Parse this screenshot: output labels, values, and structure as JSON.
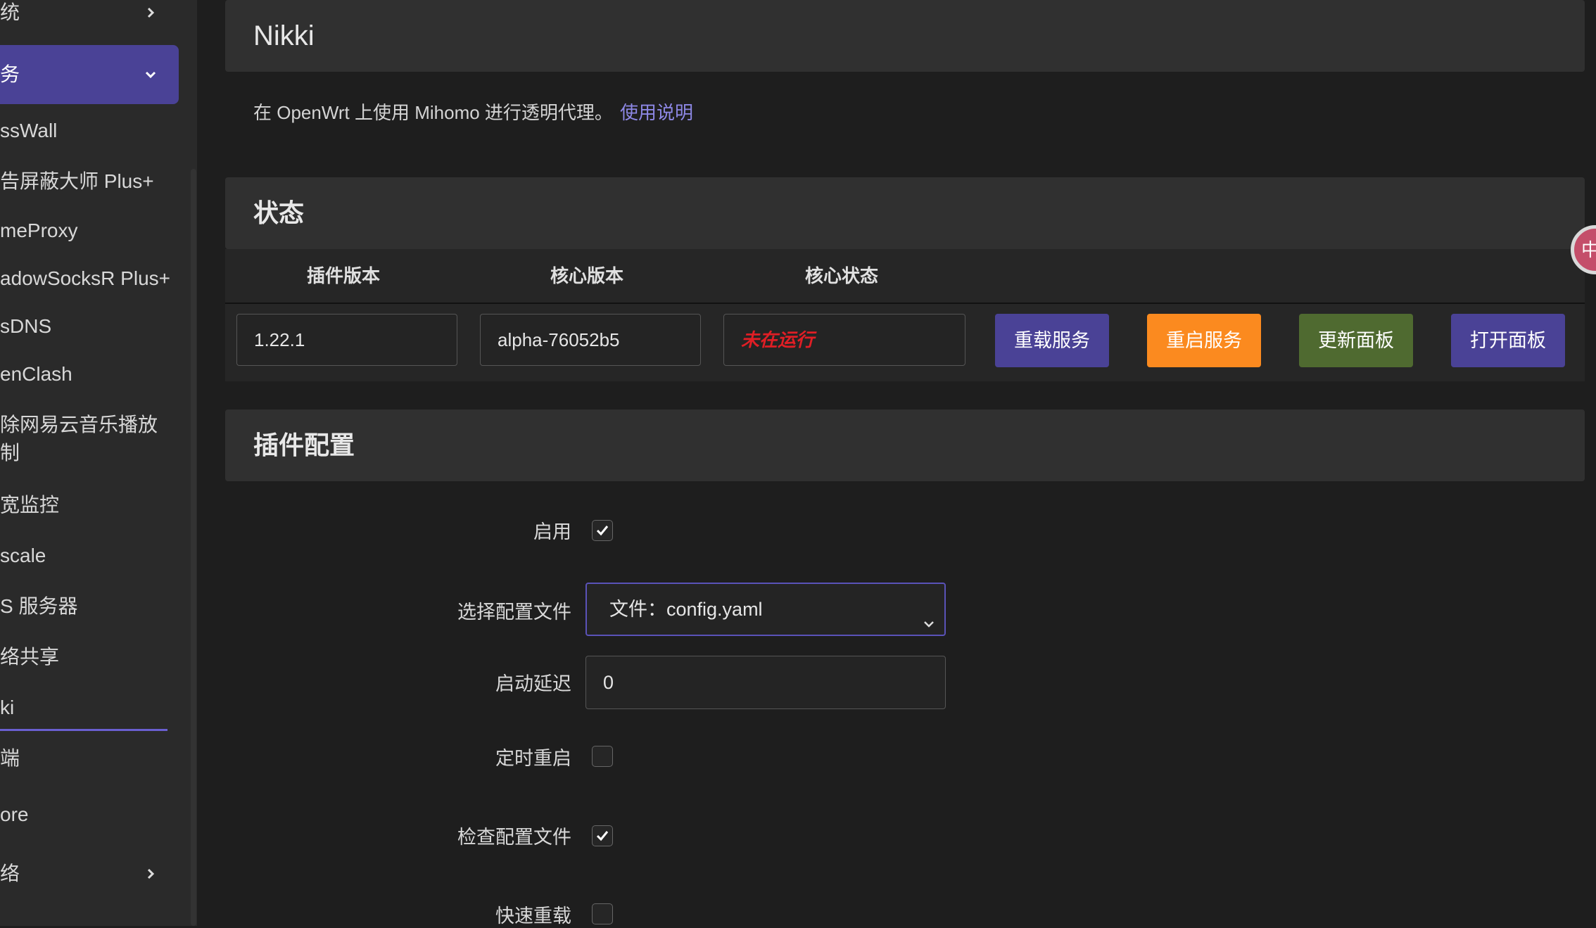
{
  "sidebar": {
    "items": [
      {
        "label": "统",
        "chevron": "right"
      },
      {
        "label": "务",
        "chevron": "down",
        "active": true
      },
      {
        "label": "ssWall"
      },
      {
        "label": "告屏蔽大师 Plus+"
      },
      {
        "label": "meProxy"
      },
      {
        "label": "adowSocksR Plus+"
      },
      {
        "label": "sDNS"
      },
      {
        "label": "enClash"
      },
      {
        "label": "除网易云音乐播放"
      },
      {
        "label": "制"
      },
      {
        "label": "宽监控"
      },
      {
        "label": "scale"
      },
      {
        "label": "S 服务器"
      },
      {
        "label": "络共享"
      },
      {
        "label": "ki",
        "selected": true
      },
      {
        "label": "端"
      },
      {
        "label": "ore"
      },
      {
        "label": "络",
        "chevron": "right"
      }
    ]
  },
  "page": {
    "title": "Nikki",
    "description": "在 OpenWrt 上使用 Mihomo 进行透明代理。",
    "doc_link": "使用说明"
  },
  "status": {
    "section_title": "状态",
    "columns": [
      "插件版本",
      "核心版本",
      "核心状态"
    ],
    "plugin_version": "1.22.1",
    "core_version": "alpha-76052b5",
    "core_status": "未在运行",
    "buttons": {
      "reload": "重载服务",
      "restart": "重启服务",
      "update_panel": "更新面板",
      "open_panel": "打开面板"
    }
  },
  "config": {
    "section_title": "插件配置",
    "enable_label": "启用",
    "enable_checked": true,
    "profile_label": "选择配置文件",
    "profile_value": "文件：config.yaml",
    "start_delay_label": "启动延迟",
    "start_delay_value": "0",
    "scheduled_restart_label": "定时重启",
    "scheduled_restart_checked": false,
    "check_config_label": "检查配置文件",
    "check_config_checked": true,
    "fast_reload_label": "快速重载",
    "fast_reload_checked": false
  },
  "floating_badge": {
    "label": "中"
  },
  "colors": {
    "accent": "#4a4296",
    "orange": "#fb8a1f",
    "green": "#4f6a30",
    "error": "#e01e25",
    "link": "#8e88e6"
  }
}
